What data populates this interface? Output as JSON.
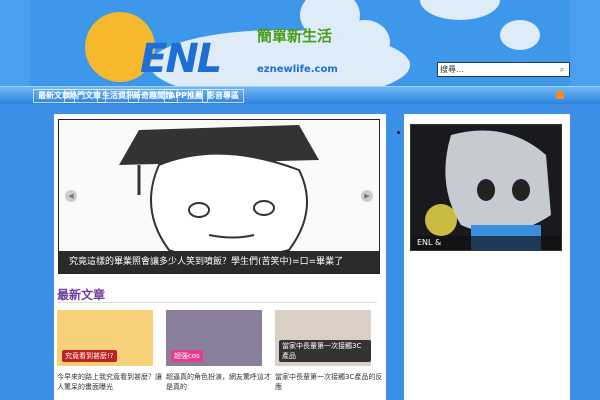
{
  "header": {
    "logo_text": "ENL",
    "logo_sub": "簡單新生活",
    "logo_url": "eznewlife.com"
  },
  "search": {
    "value": "搜尋..."
  },
  "nav": {
    "items": [
      "最新文章",
      "熱門文章",
      "生活資訊",
      "新奇趣聞館",
      "APP推薦",
      "影音專區"
    ]
  },
  "slider": {
    "caption": "究竟這樣的畢業照會讓多少人笑到噴飯？學生們(苦笑中)=口=畢業了"
  },
  "section": {
    "title": "最新文章"
  },
  "posts": [
    {
      "thumb_caption": "究竟看到甚麼!?",
      "title": "今早來的路上我究竟看到甚麼？讓人驚呆的畫面曝光"
    },
    {
      "thumb_caption": "超強cos",
      "title": "超逼真的角色扮演，網友驚呼這才是真的"
    },
    {
      "thumb_caption": "當家中長輩第一次接觸3C產品",
      "title": "當家中長輩第一次接觸3C產品的反應"
    }
  ],
  "sidebar": {
    "caption": "ENL &"
  }
}
